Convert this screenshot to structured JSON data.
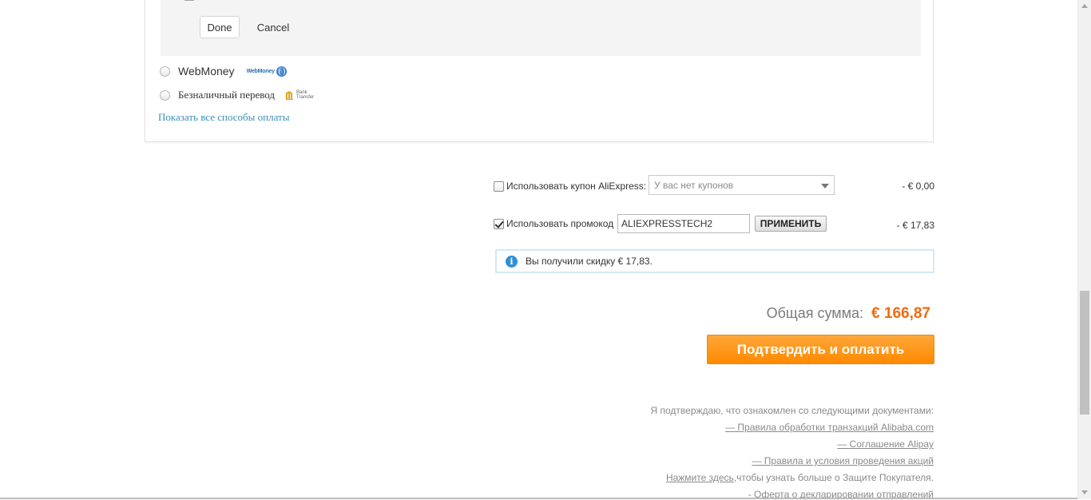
{
  "payment": {
    "done_label": "Done",
    "cancel_label": "Cancel",
    "options": [
      {
        "label": "WebMoney",
        "logo_text": "WebMoney",
        "logo_icon": "webmoney-globe-icon"
      },
      {
        "label": "Безналичный перевод",
        "logo_text_line1": "Bank",
        "logo_text_line2": "Transfer",
        "logo_icon": "bank-building-icon"
      }
    ],
    "show_all_link": "Показать все способы оплаты"
  },
  "coupon": {
    "label": "Использовать купон AliExpress:",
    "select_value": "У вас нет купонов",
    "amount": "- € 0,00",
    "checked": false
  },
  "promo": {
    "label": "Использовать промокод",
    "input_value": "ALIEXPRESSTECH2",
    "apply_label": "ПРИМЕНИТЬ",
    "amount": "- € 17,83",
    "checked": true
  },
  "info": {
    "icon": "info-icon",
    "message": "Вы получили скидку € 17,83."
  },
  "total": {
    "label": "Общая сумма:",
    "value": "€ 166,87"
  },
  "confirm_label": "Подтвердить и оплатить",
  "legal": {
    "intro": "Я подтверждаю, что ознакомлен со следующими документами:",
    "links": [
      "— Правила обработки транзакций Alibaba.com",
      "— Соглашение Alipay",
      "— Правила и условия проведения акций"
    ],
    "protection_link": "Нажмите здесь,",
    "protection_text": "чтобы узнать больше о Защите Покупателя.",
    "declaration_link": "- Оферта о декларировании отправлений"
  },
  "colors": {
    "accent_orange": "#ff8a00",
    "total_orange": "#f26a10",
    "link_blue": "#3a8fb7",
    "info_blue": "#2f8fd8"
  }
}
